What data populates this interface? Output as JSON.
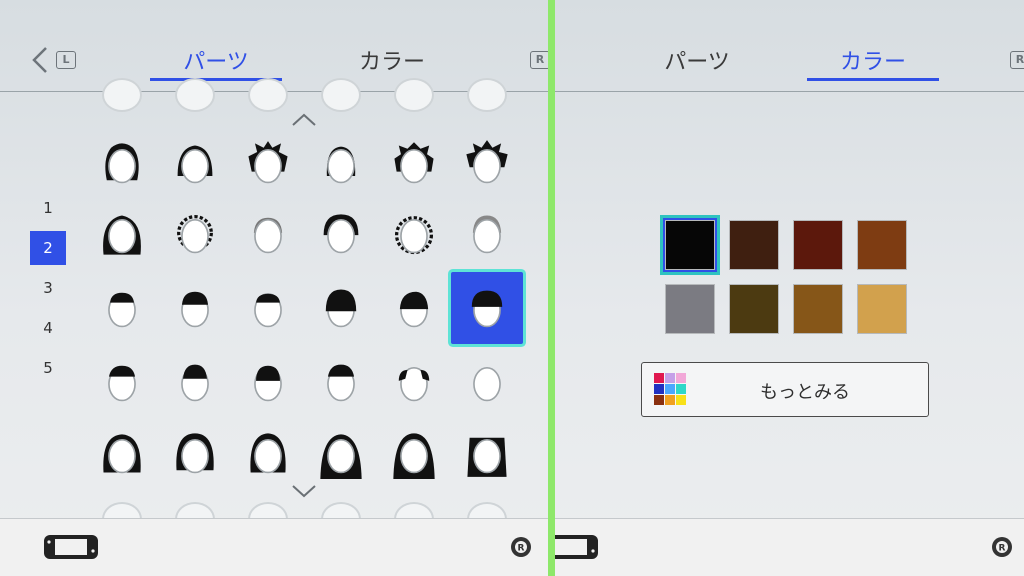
{
  "left_panel": {
    "tabs": [
      {
        "label": "パーツ",
        "active": true
      },
      {
        "label": "カラー",
        "active": false
      }
    ],
    "keys": {
      "left": "L",
      "right": "R"
    },
    "pages": [
      "1",
      "2",
      "3",
      "4",
      "5"
    ],
    "active_page": "2",
    "selected_cell": {
      "row": 2,
      "col": 5
    }
  },
  "right_panel": {
    "tabs": [
      {
        "label": "パーツ",
        "active": false
      },
      {
        "label": "カラー",
        "active": true
      }
    ],
    "keys": {
      "right": "R"
    },
    "swatches": [
      "#060606",
      "#3f1f10",
      "#5c180c",
      "#7e3c12",
      "#7b7b82",
      "#4c3a11",
      "#865618",
      "#d2a14d"
    ],
    "selected_swatch": 0,
    "more_button_label": "もっとみる",
    "mini_palette": [
      "#e0184f",
      "#c5a0e8",
      "#f2a8d8",
      "#2030c0",
      "#4aa8ff",
      "#2fd8c8",
      "#8a3010",
      "#f0a020",
      "#f8e018"
    ]
  },
  "colors": {
    "accent": "#3050e6",
    "highlight": "#5ee3d6",
    "divider": "#8ee86a"
  }
}
